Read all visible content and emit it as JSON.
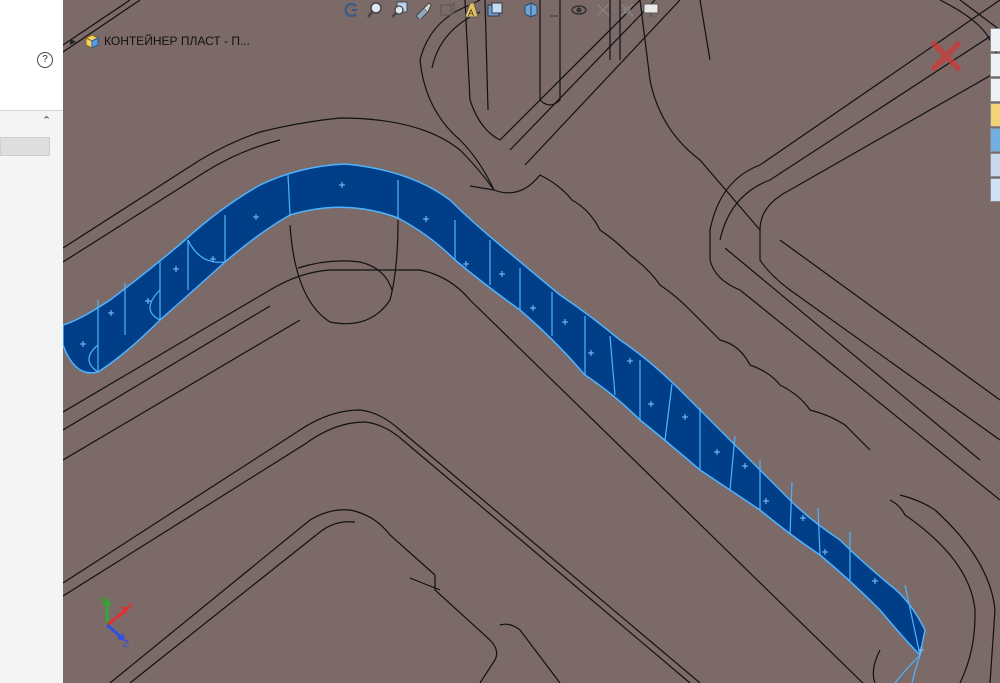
{
  "tree": {
    "part_label": "КОНТЕЙНЕР ПЛАСТ - П..."
  },
  "left_panel": {
    "help_icon": "question-circle-icon",
    "collapse_icon": "chevron-up-icon"
  },
  "toolbar": {
    "icons": [
      "previous-view-icon",
      "zoom-to-fit-icon",
      "zoom-to-area-icon",
      "section-view-icon",
      "view-orientation-icon",
      "display-style-icon",
      "hide-show-items-icon",
      "edit-appearance-icon",
      "apply-scene-icon",
      "view-settings-icon",
      "display-pane-icon"
    ]
  },
  "task_pane": {
    "tabs": [
      "home-icon",
      "resources-icon",
      "design-library-icon",
      "file-explorer-icon",
      "appearances-icon",
      "custom-properties-icon",
      "forum-icon"
    ]
  },
  "triad": {
    "x": "X",
    "y": "Y",
    "z": "Z"
  },
  "colors": {
    "background": "#7b6a68",
    "selection": "#003f87",
    "selection_edge": "#4fb4ff",
    "edge": "#111111",
    "triad_x": "#e03030",
    "triad_y": "#2faa2f",
    "triad_z": "#3050e0",
    "cancel": "#cc3b3b"
  }
}
